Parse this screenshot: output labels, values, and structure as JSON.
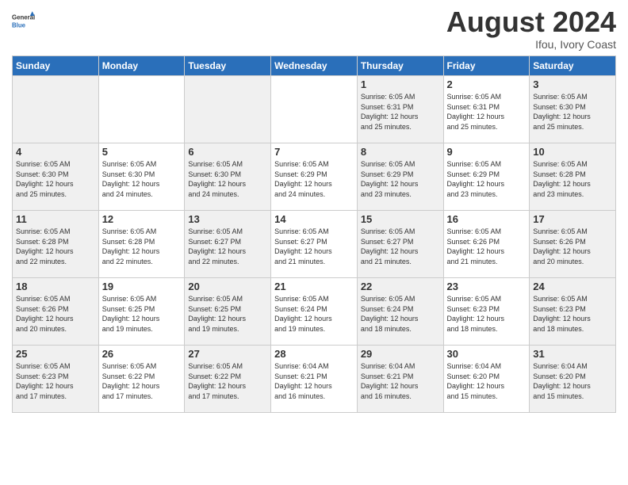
{
  "header": {
    "logo_line1": "General",
    "logo_line2": "Blue",
    "month": "August 2024",
    "location": "Ifou, Ivory Coast"
  },
  "weekdays": [
    "Sunday",
    "Monday",
    "Tuesday",
    "Wednesday",
    "Thursday",
    "Friday",
    "Saturday"
  ],
  "weeks": [
    [
      {
        "day": "",
        "info": ""
      },
      {
        "day": "",
        "info": ""
      },
      {
        "day": "",
        "info": ""
      },
      {
        "day": "",
        "info": ""
      },
      {
        "day": "1",
        "info": "Sunrise: 6:05 AM\nSunset: 6:31 PM\nDaylight: 12 hours\nand 25 minutes."
      },
      {
        "day": "2",
        "info": "Sunrise: 6:05 AM\nSunset: 6:31 PM\nDaylight: 12 hours\nand 25 minutes."
      },
      {
        "day": "3",
        "info": "Sunrise: 6:05 AM\nSunset: 6:30 PM\nDaylight: 12 hours\nand 25 minutes."
      }
    ],
    [
      {
        "day": "4",
        "info": "Sunrise: 6:05 AM\nSunset: 6:30 PM\nDaylight: 12 hours\nand 25 minutes."
      },
      {
        "day": "5",
        "info": "Sunrise: 6:05 AM\nSunset: 6:30 PM\nDaylight: 12 hours\nand 24 minutes."
      },
      {
        "day": "6",
        "info": "Sunrise: 6:05 AM\nSunset: 6:30 PM\nDaylight: 12 hours\nand 24 minutes."
      },
      {
        "day": "7",
        "info": "Sunrise: 6:05 AM\nSunset: 6:29 PM\nDaylight: 12 hours\nand 24 minutes."
      },
      {
        "day": "8",
        "info": "Sunrise: 6:05 AM\nSunset: 6:29 PM\nDaylight: 12 hours\nand 23 minutes."
      },
      {
        "day": "9",
        "info": "Sunrise: 6:05 AM\nSunset: 6:29 PM\nDaylight: 12 hours\nand 23 minutes."
      },
      {
        "day": "10",
        "info": "Sunrise: 6:05 AM\nSunset: 6:28 PM\nDaylight: 12 hours\nand 23 minutes."
      }
    ],
    [
      {
        "day": "11",
        "info": "Sunrise: 6:05 AM\nSunset: 6:28 PM\nDaylight: 12 hours\nand 22 minutes."
      },
      {
        "day": "12",
        "info": "Sunrise: 6:05 AM\nSunset: 6:28 PM\nDaylight: 12 hours\nand 22 minutes."
      },
      {
        "day": "13",
        "info": "Sunrise: 6:05 AM\nSunset: 6:27 PM\nDaylight: 12 hours\nand 22 minutes."
      },
      {
        "day": "14",
        "info": "Sunrise: 6:05 AM\nSunset: 6:27 PM\nDaylight: 12 hours\nand 21 minutes."
      },
      {
        "day": "15",
        "info": "Sunrise: 6:05 AM\nSunset: 6:27 PM\nDaylight: 12 hours\nand 21 minutes."
      },
      {
        "day": "16",
        "info": "Sunrise: 6:05 AM\nSunset: 6:26 PM\nDaylight: 12 hours\nand 21 minutes."
      },
      {
        "day": "17",
        "info": "Sunrise: 6:05 AM\nSunset: 6:26 PM\nDaylight: 12 hours\nand 20 minutes."
      }
    ],
    [
      {
        "day": "18",
        "info": "Sunrise: 6:05 AM\nSunset: 6:26 PM\nDaylight: 12 hours\nand 20 minutes."
      },
      {
        "day": "19",
        "info": "Sunrise: 6:05 AM\nSunset: 6:25 PM\nDaylight: 12 hours\nand 19 minutes."
      },
      {
        "day": "20",
        "info": "Sunrise: 6:05 AM\nSunset: 6:25 PM\nDaylight: 12 hours\nand 19 minutes."
      },
      {
        "day": "21",
        "info": "Sunrise: 6:05 AM\nSunset: 6:24 PM\nDaylight: 12 hours\nand 19 minutes."
      },
      {
        "day": "22",
        "info": "Sunrise: 6:05 AM\nSunset: 6:24 PM\nDaylight: 12 hours\nand 18 minutes."
      },
      {
        "day": "23",
        "info": "Sunrise: 6:05 AM\nSunset: 6:23 PM\nDaylight: 12 hours\nand 18 minutes."
      },
      {
        "day": "24",
        "info": "Sunrise: 6:05 AM\nSunset: 6:23 PM\nDaylight: 12 hours\nand 18 minutes."
      }
    ],
    [
      {
        "day": "25",
        "info": "Sunrise: 6:05 AM\nSunset: 6:23 PM\nDaylight: 12 hours\nand 17 minutes."
      },
      {
        "day": "26",
        "info": "Sunrise: 6:05 AM\nSunset: 6:22 PM\nDaylight: 12 hours\nand 17 minutes."
      },
      {
        "day": "27",
        "info": "Sunrise: 6:05 AM\nSunset: 6:22 PM\nDaylight: 12 hours\nand 17 minutes."
      },
      {
        "day": "28",
        "info": "Sunrise: 6:04 AM\nSunset: 6:21 PM\nDaylight: 12 hours\nand 16 minutes."
      },
      {
        "day": "29",
        "info": "Sunrise: 6:04 AM\nSunset: 6:21 PM\nDaylight: 12 hours\nand 16 minutes."
      },
      {
        "day": "30",
        "info": "Sunrise: 6:04 AM\nSunset: 6:20 PM\nDaylight: 12 hours\nand 15 minutes."
      },
      {
        "day": "31",
        "info": "Sunrise: 6:04 AM\nSunset: 6:20 PM\nDaylight: 12 hours\nand 15 minutes."
      }
    ]
  ]
}
